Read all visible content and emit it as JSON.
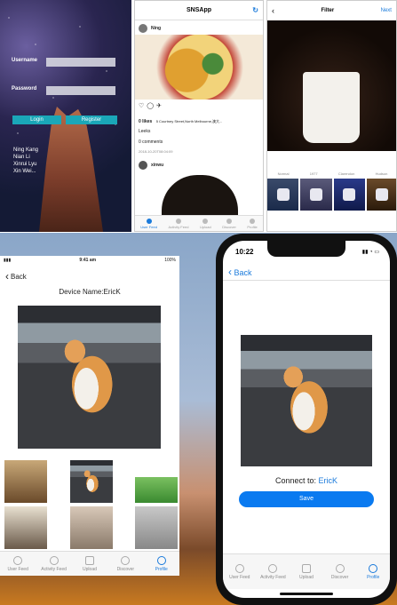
{
  "screen1": {
    "username_label": "Username",
    "password_label": "Password",
    "login_label": "Login",
    "register_label": "Register",
    "credits": [
      "Ning Kang",
      "Nian Li",
      "Xinrui Lyu",
      "Xin Wei..."
    ]
  },
  "screen2": {
    "app_title": "SNSApp",
    "author": "Ning",
    "likes": "0 likes",
    "location": "5 Courtney Street,North Melbourne,澳大...",
    "caption": "Leeks",
    "comments": "0 comments",
    "timestamp": "2018-10-20T08:04:09",
    "second_author": "xinwu",
    "tabs": [
      "User Feed",
      "Activity Feed",
      "Upload",
      "Discover",
      "Profile"
    ]
  },
  "screen3": {
    "nav_title": "Filter",
    "next_label": "Next",
    "filter_names": [
      "Normal",
      "1977",
      "Clarendon",
      "Hudson"
    ]
  },
  "screen4": {
    "back_label": "Back",
    "status_time": "9:41 am",
    "battery": "100%",
    "device_title": "Device Name:EricK",
    "tabs": [
      "User Feed",
      "Activity Feed",
      "Upload",
      "Discover",
      "Profile"
    ]
  },
  "phone": {
    "status_time": "10:22",
    "back_label": "Back",
    "connect_label": "Connect to:",
    "connect_name": "EricK",
    "save_label": "Save",
    "tabs": [
      "User Feed",
      "Activity Feed",
      "Upload",
      "Discover",
      "Profile"
    ]
  },
  "colors": {
    "accent": "#1a7adb",
    "save_button": "#0a7af0",
    "login_teal": "#1aa7b8"
  }
}
